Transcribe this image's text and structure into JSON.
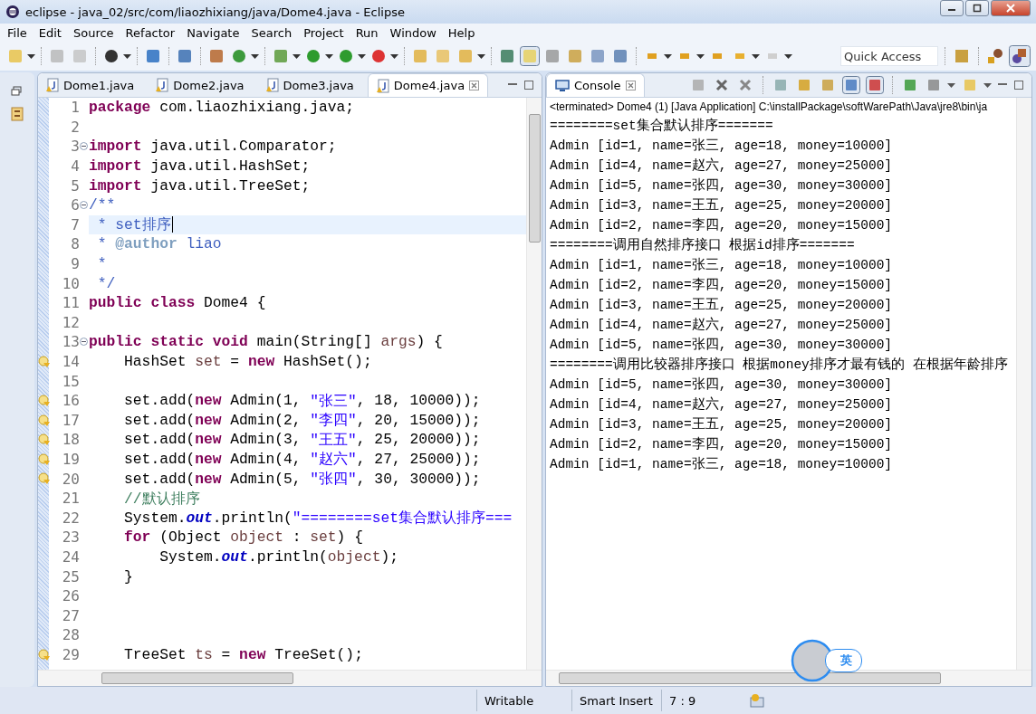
{
  "window": {
    "title": "eclipse - java_02/src/com/liaozhixiang/java/Dome4.java - Eclipse"
  },
  "menu": [
    "File",
    "Edit",
    "Source",
    "Refactor",
    "Navigate",
    "Search",
    "Project",
    "Run",
    "Window",
    "Help"
  ],
  "quick_access": {
    "placeholder": "Quick Access"
  },
  "editor": {
    "tabs": [
      {
        "label": "Dome1.java",
        "selected": false
      },
      {
        "label": "Dome2.java",
        "selected": false
      },
      {
        "label": "Dome3.java",
        "selected": false
      },
      {
        "label": "Dome4.java",
        "selected": true
      }
    ],
    "lines": [
      {
        "number": "1",
        "fold": false,
        "warning": false,
        "current": false,
        "tokens": [
          {
            "kind": "keyword",
            "text": "package"
          },
          {
            "kind": "plain",
            "text": " com.liaozhixiang.java;"
          }
        ]
      },
      {
        "number": "2",
        "fold": false,
        "warning": false,
        "current": false
      },
      {
        "number": "3",
        "fold": true,
        "warning": false,
        "current": false,
        "tokens": [
          {
            "kind": "keyword",
            "text": "import"
          },
          {
            "kind": "plain",
            "text": " java.util.Comparator;"
          }
        ]
      },
      {
        "number": "4",
        "fold": false,
        "warning": false,
        "current": false,
        "tokens": [
          {
            "kind": "keyword",
            "text": "import"
          },
          {
            "kind": "plain",
            "text": " java.util.HashSet;"
          }
        ]
      },
      {
        "number": "5",
        "fold": false,
        "warning": false,
        "current": false,
        "tokens": [
          {
            "kind": "keyword",
            "text": "import"
          },
          {
            "kind": "plain",
            "text": " java.util.TreeSet;"
          }
        ]
      },
      {
        "number": "6",
        "fold": true,
        "warning": false,
        "current": false,
        "tokens": [
          {
            "kind": "javadoc",
            "text": "/**"
          }
        ]
      },
      {
        "number": "7",
        "fold": false,
        "warning": false,
        "current": true,
        "tokens": [
          {
            "kind": "javadoc",
            "text": " * set排序"
          }
        ]
      },
      {
        "number": "8",
        "fold": false,
        "warning": false,
        "current": false,
        "tokens": [
          {
            "kind": "javadoc",
            "text": " * "
          },
          {
            "kind": "tag",
            "text": "@author"
          },
          {
            "kind": "javadoc",
            "text": " liao"
          }
        ]
      },
      {
        "number": "9",
        "fold": false,
        "warning": false,
        "current": false,
        "tokens": [
          {
            "kind": "javadoc",
            "text": " *"
          }
        ]
      },
      {
        "number": "10",
        "fold": false,
        "warning": false,
        "current": false,
        "tokens": [
          {
            "kind": "javadoc",
            "text": " */"
          }
        ]
      },
      {
        "number": "11",
        "fold": false,
        "warning": false,
        "current": false,
        "tokens": [
          {
            "kind": "keyword",
            "text": "public class"
          },
          {
            "kind": "plain",
            "text": " Dome4 {"
          }
        ]
      },
      {
        "number": "12",
        "fold": false,
        "warning": false,
        "current": false
      },
      {
        "number": "13",
        "fold": true,
        "warning": false,
        "current": false,
        "tokens": [
          {
            "kind": "keyword",
            "text": "public static void"
          },
          {
            "kind": "plain",
            "text": " main(String[] "
          },
          {
            "kind": "variable",
            "text": "args"
          },
          {
            "kind": "plain",
            "text": ") {"
          }
        ]
      },
      {
        "number": "14",
        "fold": false,
        "warning": true,
        "current": false,
        "tokens": [
          {
            "kind": "plain",
            "text": "    HashSet "
          },
          {
            "kind": "variable",
            "text": "set"
          },
          {
            "kind": "plain",
            "text": " = "
          },
          {
            "kind": "keyword",
            "text": "new"
          },
          {
            "kind": "plain",
            "text": " HashSet();"
          }
        ]
      },
      {
        "number": "15",
        "fold": false,
        "warning": false,
        "current": false
      },
      {
        "number": "16",
        "fold": false,
        "warning": true,
        "current": false,
        "tokens": [
          {
            "kind": "plain",
            "text": "    set.add("
          },
          {
            "kind": "keyword",
            "text": "new"
          },
          {
            "kind": "plain",
            "text": " Admin(1, "
          },
          {
            "kind": "string",
            "text": "\"张三\""
          },
          {
            "kind": "plain",
            "text": ", 18, 10000));"
          }
        ]
      },
      {
        "number": "17",
        "fold": false,
        "warning": true,
        "current": false,
        "tokens": [
          {
            "kind": "plain",
            "text": "    set.add("
          },
          {
            "kind": "keyword",
            "text": "new"
          },
          {
            "kind": "plain",
            "text": " Admin(2, "
          },
          {
            "kind": "string",
            "text": "\"李四\""
          },
          {
            "kind": "plain",
            "text": ", 20, 15000));"
          }
        ]
      },
      {
        "number": "18",
        "fold": false,
        "warning": true,
        "current": false,
        "tokens": [
          {
            "kind": "plain",
            "text": "    set.add("
          },
          {
            "kind": "keyword",
            "text": "new"
          },
          {
            "kind": "plain",
            "text": " Admin(3, "
          },
          {
            "kind": "string",
            "text": "\"王五\""
          },
          {
            "kind": "plain",
            "text": ", 25, 20000));"
          }
        ]
      },
      {
        "number": "19",
        "fold": false,
        "warning": true,
        "current": false,
        "tokens": [
          {
            "kind": "plain",
            "text": "    set.add("
          },
          {
            "kind": "keyword",
            "text": "new"
          },
          {
            "kind": "plain",
            "text": " Admin(4, "
          },
          {
            "kind": "string",
            "text": "\"赵六\""
          },
          {
            "kind": "plain",
            "text": ", 27, 25000));"
          }
        ]
      },
      {
        "number": "20",
        "fold": false,
        "warning": true,
        "current": false,
        "tokens": [
          {
            "kind": "plain",
            "text": "    set.add("
          },
          {
            "kind": "keyword",
            "text": "new"
          },
          {
            "kind": "plain",
            "text": " Admin(5, "
          },
          {
            "kind": "string",
            "text": "\"张四\""
          },
          {
            "kind": "plain",
            "text": ", 30, 30000));"
          }
        ]
      },
      {
        "number": "21",
        "fold": false,
        "warning": false,
        "current": false,
        "tokens": [
          {
            "kind": "comment",
            "text": "    //默认排序"
          }
        ]
      },
      {
        "number": "22",
        "fold": false,
        "warning": false,
        "current": false,
        "tokens": [
          {
            "kind": "plain",
            "text": "    System."
          },
          {
            "kind": "field",
            "text": "out"
          },
          {
            "kind": "plain",
            "text": ".println("
          },
          {
            "kind": "string",
            "text": "\"========set集合默认排序==="
          }
        ]
      },
      {
        "number": "23",
        "fold": false,
        "warning": false,
        "current": false,
        "tokens": [
          {
            "kind": "keyword",
            "text": "    for"
          },
          {
            "kind": "plain",
            "text": " (Object "
          },
          {
            "kind": "variable",
            "text": "object"
          },
          {
            "kind": "plain",
            "text": " : "
          },
          {
            "kind": "variable",
            "text": "set"
          },
          {
            "kind": "plain",
            "text": ") {"
          }
        ]
      },
      {
        "number": "24",
        "fold": false,
        "warning": false,
        "current": false,
        "tokens": [
          {
            "kind": "plain",
            "text": "        System."
          },
          {
            "kind": "field",
            "text": "out"
          },
          {
            "kind": "plain",
            "text": ".println("
          },
          {
            "kind": "variable",
            "text": "object"
          },
          {
            "kind": "plain",
            "text": ");"
          }
        ]
      },
      {
        "number": "25",
        "fold": false,
        "warning": false,
        "current": false,
        "tokens": [
          {
            "kind": "plain",
            "text": "    }"
          }
        ]
      },
      {
        "number": "26",
        "fold": false,
        "warning": false,
        "current": false
      },
      {
        "number": "27",
        "fold": false,
        "warning": false,
        "current": false
      },
      {
        "number": "28",
        "fold": false,
        "warning": false,
        "current": false
      },
      {
        "number": "29",
        "fold": false,
        "warning": true,
        "current": false,
        "tokens": [
          {
            "kind": "plain",
            "text": "    TreeSet "
          },
          {
            "kind": "variable",
            "text": "ts"
          },
          {
            "kind": "plain",
            "text": " = "
          },
          {
            "kind": "keyword",
            "text": "new"
          },
          {
            "kind": "plain",
            "text": " TreeSet();"
          }
        ]
      }
    ]
  },
  "console": {
    "tab": "Console",
    "header": "<terminated> Dome4 (1) [Java Application] C:\\installPackage\\softWarePath\\Java\\jre8\\bin\\ja",
    "lines": [
      "========set集合默认排序=======",
      "Admin [id=1, name=张三, age=18, money=10000]",
      "Admin [id=4, name=赵六, age=27, money=25000]",
      "Admin [id=5, name=张四, age=30, money=30000]",
      "Admin [id=3, name=王五, age=25, money=20000]",
      "Admin [id=2, name=李四, age=20, money=15000]",
      "========调用自然排序接口 根据id排序=======",
      "Admin [id=1, name=张三, age=18, money=10000]",
      "Admin [id=2, name=李四, age=20, money=15000]",
      "Admin [id=3, name=王五, age=25, money=20000]",
      "Admin [id=4, name=赵六, age=27, money=25000]",
      "Admin [id=5, name=张四, age=30, money=30000]",
      "========调用比较器排序接口 根据money排序才最有钱的 在根据年龄排序",
      "Admin [id=5, name=张四, age=30, money=30000]",
      "Admin [id=4, name=赵六, age=27, money=25000]",
      "Admin [id=3, name=王五, age=25, money=20000]",
      "Admin [id=2, name=李四, age=20, money=15000]",
      "Admin [id=1, name=张三, age=18, money=10000]"
    ]
  },
  "ime": {
    "label": "英"
  },
  "status_bar": {
    "mode": "Writable",
    "insert": "Smart Insert",
    "position": "7 : 9"
  }
}
